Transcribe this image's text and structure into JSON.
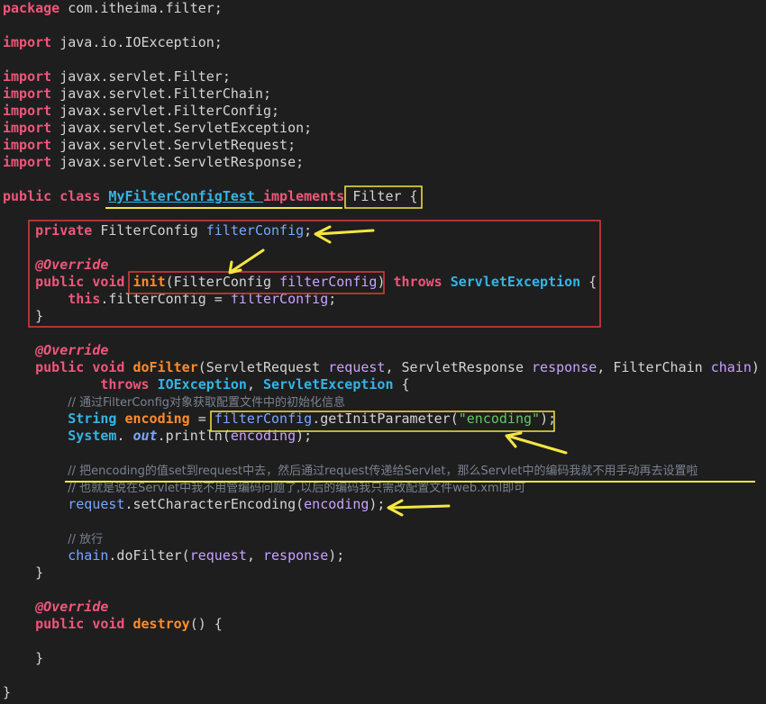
{
  "code_lines": [
    [
      [
        "kw",
        "package"
      ],
      [
        "",
        "com.itheima.filter;"
      ]
    ],
    [],
    [
      [
        "kw",
        "import"
      ],
      [
        "",
        "java.io.IOException;"
      ]
    ],
    [],
    [
      [
        "kw",
        "import"
      ],
      [
        "",
        "javax.servlet.Filter;"
      ]
    ],
    [
      [
        "kw",
        "import"
      ],
      [
        "",
        "javax.servlet.FilterChain;"
      ]
    ],
    [
      [
        "kw",
        "import"
      ],
      [
        "",
        "javax.servlet.FilterConfig;"
      ]
    ],
    [
      [
        "kw",
        "import"
      ],
      [
        "",
        "javax.servlet.ServletException;"
      ]
    ],
    [
      [
        "kw",
        "import"
      ],
      [
        "",
        "javax.servlet.ServletRequest;"
      ]
    ],
    [
      [
        "kw",
        "import"
      ],
      [
        "",
        "javax.servlet.ServletResponse;"
      ]
    ],
    [],
    [
      [
        "kw",
        "public"
      ],
      [
        "kw",
        "class"
      ],
      [
        "cls-ul",
        "MyFilterConfigTest"
      ],
      [
        "kw",
        "implements"
      ],
      [
        "",
        "Filter {"
      ]
    ],
    [],
    [
      [
        "",
        "    "
      ],
      [
        "kw",
        "private"
      ],
      [
        "",
        "FilterConfig "
      ],
      [
        "fld",
        "filterConfig"
      ],
      [
        "",
        ";"
      ]
    ],
    [],
    [
      [
        "",
        "    "
      ],
      [
        "ann",
        "@Override"
      ]
    ],
    [
      [
        "",
        "    "
      ],
      [
        "kw",
        "public"
      ],
      [
        "kw",
        "void"
      ],
      [
        "mth",
        "init"
      ],
      [
        "",
        "(FilterConfig "
      ],
      [
        "var",
        "filterConfig"
      ],
      [
        "",
        ")"
      ],
      [
        "kw",
        " throws"
      ],
      [
        "cls",
        "ServletException"
      ],
      [
        "",
        "{"
      ]
    ],
    [
      [
        "",
        "        "
      ],
      [
        "kw2",
        "this"
      ],
      [
        "",
        ".filterConfig = "
      ],
      [
        "var",
        "filterConfig"
      ],
      [
        "",
        ";"
      ]
    ],
    [
      [
        "",
        "    }"
      ]
    ],
    [],
    [
      [
        "",
        "    "
      ],
      [
        "ann",
        "@Override"
      ]
    ],
    [
      [
        "",
        "    "
      ],
      [
        "kw",
        "public"
      ],
      [
        "kw",
        "void"
      ],
      [
        "mth",
        "doFilter"
      ],
      [
        "",
        "(ServletRequest "
      ],
      [
        "var",
        "request"
      ],
      [
        "",
        ", ServletResponse "
      ],
      [
        "var",
        "response"
      ],
      [
        "",
        ", FilterChain "
      ],
      [
        "var",
        "chain"
      ],
      [
        "",
        ")"
      ]
    ],
    [
      [
        "",
        "            "
      ],
      [
        "kw",
        "throws"
      ],
      [
        "cls",
        "IOException"
      ],
      [
        "",
        ", "
      ],
      [
        "cls",
        "ServletException"
      ],
      [
        "",
        "{"
      ]
    ],
    [
      [
        "",
        "        "
      ],
      [
        "cm",
        "// 通过FilterConfig对象获取配置文件中的初始化信息"
      ]
    ],
    [
      [
        "",
        "        "
      ],
      [
        "cls",
        "String"
      ],
      [
        "mth",
        "encoding"
      ],
      [
        "",
        "= "
      ],
      [
        "fld",
        "filterConfig"
      ],
      [
        "",
        ".getInitParameter("
      ],
      [
        "str",
        "\"encoding\""
      ],
      [
        "",
        ");"
      ]
    ],
    [
      [
        "",
        "        "
      ],
      [
        "cls",
        "System"
      ],
      [
        "",
        ". "
      ],
      [
        "st",
        "out"
      ],
      [
        "",
        ".println("
      ],
      [
        "var",
        "encoding"
      ],
      [
        "",
        ");"
      ]
    ],
    [],
    [
      [
        "",
        "        "
      ],
      [
        "cm",
        "// 把encoding的值set到request中去，然后通过request传递给Servlet，那么Servlet中的编码我就不用手动再去设置啦"
      ]
    ],
    [
      [
        "",
        "        "
      ],
      [
        "cm",
        "// 也就是说在Servlet中我不用管编码问题了,以后的编码我只需改配置文件web.xml即可"
      ]
    ],
    [
      [
        "",
        "        "
      ],
      [
        "fld",
        "request"
      ],
      [
        "",
        ".setCharacterEncoding("
      ],
      [
        "var",
        "encoding"
      ],
      [
        "",
        ");"
      ]
    ],
    [],
    [
      [
        "",
        "        "
      ],
      [
        "cm",
        "// 放行"
      ]
    ],
    [
      [
        "",
        "        "
      ],
      [
        "fld",
        "chain"
      ],
      [
        "",
        ".doFilter("
      ],
      [
        "var",
        "request"
      ],
      [
        "",
        ", "
      ],
      [
        "var",
        "response"
      ],
      [
        "",
        ");"
      ]
    ],
    [
      [
        "",
        "    }"
      ]
    ],
    [],
    [
      [
        "",
        "    "
      ],
      [
        "ann",
        "@Override"
      ]
    ],
    [
      [
        "",
        "    "
      ],
      [
        "kw",
        "public"
      ],
      [
        "kw",
        "void"
      ],
      [
        "mth",
        "destroy"
      ],
      [
        "",
        "() {"
      ]
    ],
    [],
    [
      [
        "",
        "    }"
      ]
    ],
    [],
    [
      [
        "",
        "}"
      ]
    ]
  ],
  "colors": {
    "background": "#1e1e1e",
    "keyword": "#f0567a",
    "type": "#33b5e5",
    "method": "#ff8c2b",
    "string": "#64c864",
    "comment": "#7a8290",
    "highlight_red": "#e03c3c",
    "highlight_yellow": "#f5e642"
  },
  "annotations": {
    "boxes": [
      "filter-interface-box",
      "field-and-init-box",
      "init-signature-box",
      "get-init-parameter-box"
    ],
    "arrows": [
      "field-arrow",
      "init-arrow",
      "encoding-param-arrow",
      "set-encoding-arrow"
    ],
    "underlines": [
      "class-declaration-underline",
      "set-request-comment-underline"
    ]
  }
}
